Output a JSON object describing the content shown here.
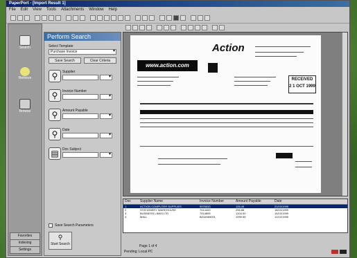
{
  "window": {
    "title": "PaperPort - [Import Result 1]"
  },
  "menu": [
    "File",
    "Edit",
    "View",
    "Tools",
    "Attachments",
    "Window",
    "Help"
  ],
  "sidebar": {
    "items": [
      {
        "label": "Search",
        "icon": "search-icon"
      },
      {
        "label": "Retrieve",
        "icon": "folder-icon"
      },
      {
        "label": "Browse",
        "icon": "browse-icon"
      }
    ],
    "bottom": [
      "Favorites",
      "Indexing",
      "Settings"
    ]
  },
  "search_panel": {
    "title": "Perform Search",
    "template_label": "Select Template",
    "template_value": "Purchase Invoice",
    "save_button": "Save Search",
    "clear_button": "Clear Criteria",
    "fields": [
      {
        "label": "Supplier",
        "icon": "magnifier-icon"
      },
      {
        "label": "Invoice Number",
        "icon": "magnifier-icon"
      },
      {
        "label": "Amount Payable",
        "icon": "magnifier-icon"
      },
      {
        "label": "Date",
        "icon": "magnifier-icon"
      },
      {
        "label": "Doc Subject",
        "icon": "document-icon"
      }
    ],
    "checkbox_label": "Save Search Parameters",
    "search_button": "Start Search"
  },
  "document": {
    "logo": "Action",
    "banner": "www.action.com",
    "stamp_line1": "RECEIVED",
    "stamp_line2": "2 1 OCT 1999"
  },
  "results": {
    "columns": [
      "Doc",
      "Supplier Name",
      "Invoice Number",
      "Amount Payable",
      "Date"
    ],
    "rows": [
      [
        "1",
        "ACTION COMPUTER SUPPLIES",
        "9976533",
        "126.49",
        "21/10/1999"
      ],
      [
        "2",
        "STATIONERY WAREHOUSE",
        "7014400",
        "256.88",
        "18/10/1999"
      ],
      [
        "3",
        "BUSINESS LINKS LTD",
        "7514895",
        "1204.50",
        "15/10/1999"
      ],
      [
        "4",
        "MALL",
        "BZ44569001",
        "1999.55",
        "12/10/1999"
      ]
    ]
  },
  "status": {
    "page": "Page 1 of 4",
    "left": "Pending: Local PC"
  },
  "colors": {
    "title_bar": "#0a246a",
    "panel_header": "#3a6ea5",
    "selection": "#0a246a"
  }
}
